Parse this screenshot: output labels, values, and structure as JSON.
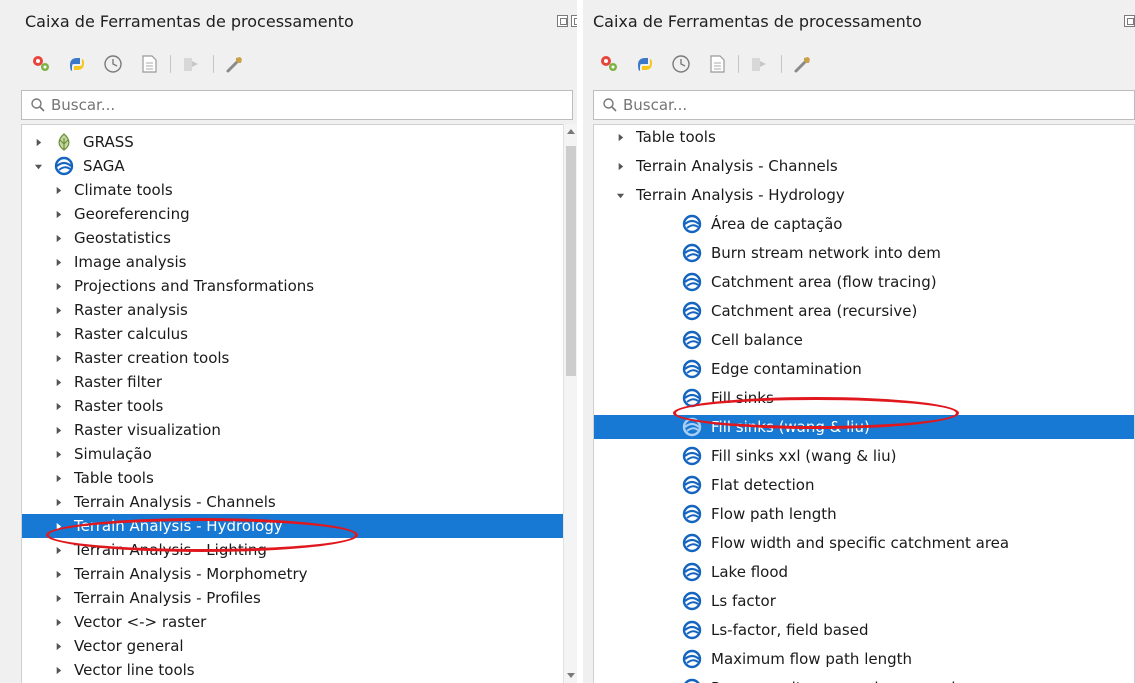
{
  "left": {
    "title": "Caixa de Ferramentas de processamento",
    "search_placeholder": "Buscar...",
    "toolbar": [
      "processing-models-icon",
      "python-scripts-icon",
      "history-icon",
      "results-viewer-icon",
      "edit-features-in-place-icon",
      "options-wrench-icon"
    ],
    "tree": [
      {
        "label": "GRASS",
        "level": 0,
        "arrow": "collapsed",
        "icon": "grass-icon"
      },
      {
        "label": "SAGA",
        "level": 0,
        "arrow": "expanded",
        "icon": "saga-icon"
      },
      {
        "label": "Climate tools",
        "level": 1,
        "arrow": "collapsed"
      },
      {
        "label": "Georeferencing",
        "level": 1,
        "arrow": "collapsed"
      },
      {
        "label": "Geostatistics",
        "level": 1,
        "arrow": "collapsed"
      },
      {
        "label": "Image analysis",
        "level": 1,
        "arrow": "collapsed"
      },
      {
        "label": "Projections and Transformations",
        "level": 1,
        "arrow": "collapsed"
      },
      {
        "label": "Raster analysis",
        "level": 1,
        "arrow": "collapsed"
      },
      {
        "label": "Raster calculus",
        "level": 1,
        "arrow": "collapsed"
      },
      {
        "label": "Raster creation tools",
        "level": 1,
        "arrow": "collapsed"
      },
      {
        "label": "Raster filter",
        "level": 1,
        "arrow": "collapsed"
      },
      {
        "label": "Raster tools",
        "level": 1,
        "arrow": "collapsed"
      },
      {
        "label": "Raster visualization",
        "level": 1,
        "arrow": "collapsed"
      },
      {
        "label": "Simulação",
        "level": 1,
        "arrow": "collapsed"
      },
      {
        "label": "Table tools",
        "level": 1,
        "arrow": "collapsed"
      },
      {
        "label": "Terrain Analysis - Channels",
        "level": 1,
        "arrow": "collapsed"
      },
      {
        "label": "Terrain Analysis - Hydrology",
        "level": 1,
        "arrow": "collapsed",
        "selected": true
      },
      {
        "label": "Terrain Analysis - Lighting",
        "level": 1,
        "arrow": "collapsed"
      },
      {
        "label": "Terrain Analysis - Morphometry",
        "level": 1,
        "arrow": "collapsed"
      },
      {
        "label": "Terrain Analysis - Profiles",
        "level": 1,
        "arrow": "collapsed"
      },
      {
        "label": "Vector <-> raster",
        "level": 1,
        "arrow": "collapsed"
      },
      {
        "label": "Vector general",
        "level": 1,
        "arrow": "collapsed"
      },
      {
        "label": "Vector line tools",
        "level": 1,
        "arrow": "collapsed"
      }
    ]
  },
  "right": {
    "title": "Caixa de Ferramentas de processamento",
    "search_placeholder": "Buscar...",
    "toolbar": [
      "processing-models-icon",
      "python-scripts-icon",
      "history-icon",
      "results-viewer-icon",
      "edit-features-in-place-icon",
      "options-wrench-icon"
    ],
    "tree": [
      {
        "label": "Table tools",
        "level": 1,
        "arrow": "collapsed"
      },
      {
        "label": "Terrain Analysis - Channels",
        "level": 1,
        "arrow": "collapsed"
      },
      {
        "label": "Terrain Analysis - Hydrology",
        "level": 1,
        "arrow": "expanded"
      },
      {
        "label": "Área de captação",
        "level": 2,
        "icon": "saga-icon"
      },
      {
        "label": "Burn stream network into dem",
        "level": 2,
        "icon": "saga-icon"
      },
      {
        "label": "Catchment area (flow tracing)",
        "level": 2,
        "icon": "saga-icon"
      },
      {
        "label": "Catchment area (recursive)",
        "level": 2,
        "icon": "saga-icon"
      },
      {
        "label": "Cell balance",
        "level": 2,
        "icon": "saga-icon"
      },
      {
        "label": "Edge contamination",
        "level": 2,
        "icon": "saga-icon"
      },
      {
        "label": "Fill sinks",
        "level": 2,
        "icon": "saga-icon"
      },
      {
        "label": "Fill sinks (wang & liu)",
        "level": 2,
        "icon": "saga-icon",
        "selected": true
      },
      {
        "label": "Fill sinks xxl (wang & liu)",
        "level": 2,
        "icon": "saga-icon"
      },
      {
        "label": "Flat detection",
        "level": 2,
        "icon": "saga-icon"
      },
      {
        "label": "Flow path length",
        "level": 2,
        "icon": "saga-icon"
      },
      {
        "label": "Flow width and specific catchment area",
        "level": 2,
        "icon": "saga-icon"
      },
      {
        "label": "Lake flood",
        "level": 2,
        "icon": "saga-icon"
      },
      {
        "label": "Ls factor",
        "level": 2,
        "icon": "saga-icon"
      },
      {
        "label": "Ls-factor, field based",
        "level": 2,
        "icon": "saga-icon"
      },
      {
        "label": "Maximum flow path length",
        "level": 2,
        "icon": "saga-icon"
      },
      {
        "label": "Paramemelton ruggedness number",
        "level": 2,
        "icon": "saga-icon"
      }
    ]
  },
  "colors": {
    "selection": "#1779d4",
    "annotation": "#e0181e",
    "saga": "#1565c0"
  }
}
